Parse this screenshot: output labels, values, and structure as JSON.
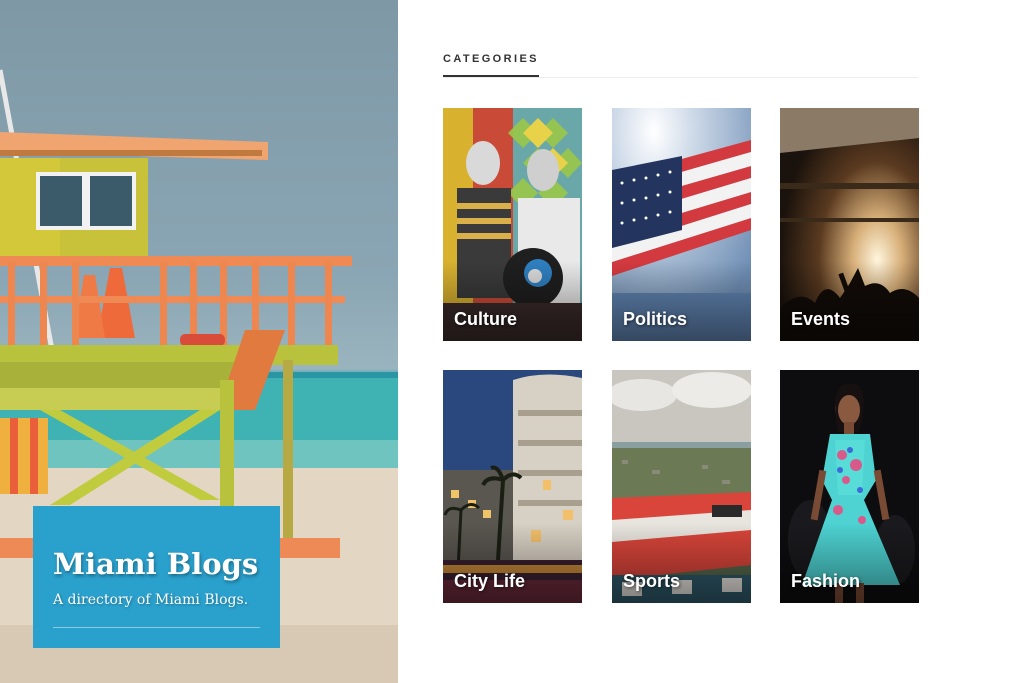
{
  "hero": {
    "site_title": "Miami Blogs",
    "tagline": "A directory of Miami Blogs.",
    "image": "lifeguard-tower-beach-photo",
    "brand_color": "#2aa0cc"
  },
  "categories": {
    "heading": "CATEGORIES",
    "items": [
      {
        "label": "Culture",
        "image": "street-mural-photo"
      },
      {
        "label": "Politics",
        "image": "american-flag-photo"
      },
      {
        "label": "Events",
        "image": "concert-crowd-photo"
      },
      {
        "label": "City Life",
        "image": "night-street-photo"
      },
      {
        "label": "Sports",
        "image": "stadium-aerial-photo"
      },
      {
        "label": "Fashion",
        "image": "runway-model-photo"
      }
    ]
  }
}
